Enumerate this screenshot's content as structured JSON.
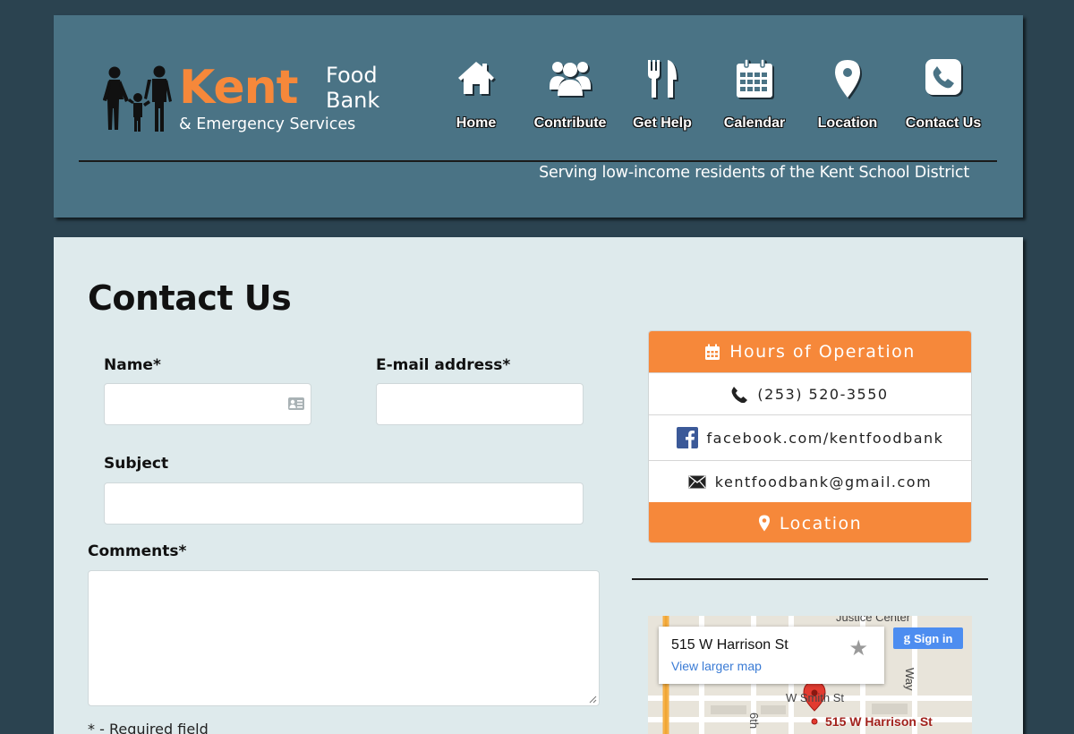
{
  "logo": {
    "kent": "Kent",
    "food": "Food",
    "bank": "Bank",
    "subtitle": "& Emergency Services"
  },
  "nav": {
    "items": [
      {
        "label": "Home",
        "icon": "home-icon"
      },
      {
        "label": "Contribute",
        "icon": "users-icon"
      },
      {
        "label": "Get Help",
        "icon": "utensils-icon"
      },
      {
        "label": "Calendar",
        "icon": "calendar-icon"
      },
      {
        "label": "Location",
        "icon": "map-marker-icon"
      },
      {
        "label": "Contact Us",
        "icon": "phone-icon"
      }
    ]
  },
  "header": {
    "tagline": "Serving low-income residents of the Kent School District"
  },
  "page": {
    "title": "Contact Us"
  },
  "form": {
    "name_label": "Name*",
    "email_label": "E-mail address*",
    "subject_label": "Subject",
    "comments_label": "Comments*",
    "name_value": "",
    "email_value": "",
    "subject_value": "",
    "comments_value": "",
    "required_note": "* - Required field"
  },
  "contact_panel": {
    "hours_label": "Hours of Operation",
    "phone": "(253) 520-3550",
    "facebook": "facebook.com/kentfoodbank",
    "email": "kentfoodbank@gmail.com",
    "location_label": "Location"
  },
  "map": {
    "address": "515 W Harrison St",
    "view_larger": "View larger map",
    "sign_in": "Sign in",
    "star": "★",
    "pin_label": "515 W Harrison St",
    "street_top": "Justice Center",
    "street_w_smith": "W Smith St",
    "street_6th": "6th",
    "street_way": "Way"
  },
  "colors": {
    "background": "#2b4350",
    "header_bg": "#4a7385",
    "content_bg": "#deeaec",
    "accent_orange": "#f6883a"
  }
}
